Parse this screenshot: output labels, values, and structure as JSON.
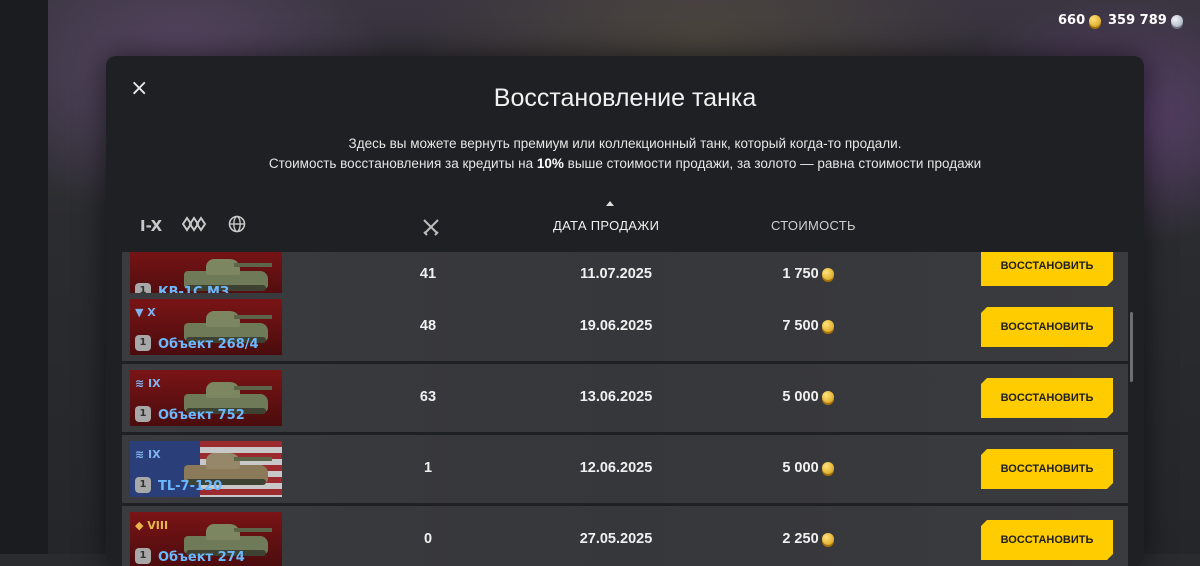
{
  "hud": {
    "gold": "660",
    "silver": "359 789"
  },
  "modal": {
    "close": "×",
    "title": "Восстановление танка",
    "desc_line1": "Здесь вы можете вернуть премиум или коллекционный танк, который когда-то продали.",
    "desc_line2_pre": "Стоимость восстановления за кредиты на ",
    "desc_line2_bold": "10%",
    "desc_line2_post": " выше стоимости продажи, за золото — равна стоимости продажи"
  },
  "filters": {
    "tier_filter": "I-X",
    "type_icon": "tank-type-icon",
    "nation_icon": "globe-icon"
  },
  "columns": {
    "battles_icon": "crossed-swords-icon",
    "date": "ДАТА ПРОДАЖИ",
    "price": "СТОИМОСТЬ"
  },
  "rows": [
    {
      "tier": "",
      "name": "КВ-1С МЗ",
      "nation": "ussr",
      "battles": "41",
      "date": "11.07.2025",
      "price": "1 750",
      "action": "ВОССТАНОВИТЬ"
    },
    {
      "tier": "▼ X",
      "name": "Объект 268/4",
      "nation": "ussr",
      "battles": "48",
      "date": "19.06.2025",
      "price": "7 500",
      "action": "ВОССТАНОВИТЬ"
    },
    {
      "tier": "≋ IX",
      "name": "Объект 752",
      "nation": "ussr",
      "battles": "63",
      "date": "13.06.2025",
      "price": "5 000",
      "action": "ВОССТАНОВИТЬ"
    },
    {
      "tier": "≋ IX",
      "name": "TL-7-120",
      "nation": "usa",
      "battles": "1",
      "date": "12.06.2025",
      "price": "5 000",
      "action": "ВОССТАНОВИТЬ"
    },
    {
      "tier": "◆ VIII",
      "name": "Объект 274",
      "nation": "ussr",
      "battles": "0",
      "date": "27.05.2025",
      "price": "2 250",
      "action": "ВОССТАНОВИТЬ"
    }
  ],
  "level_badge": "1"
}
